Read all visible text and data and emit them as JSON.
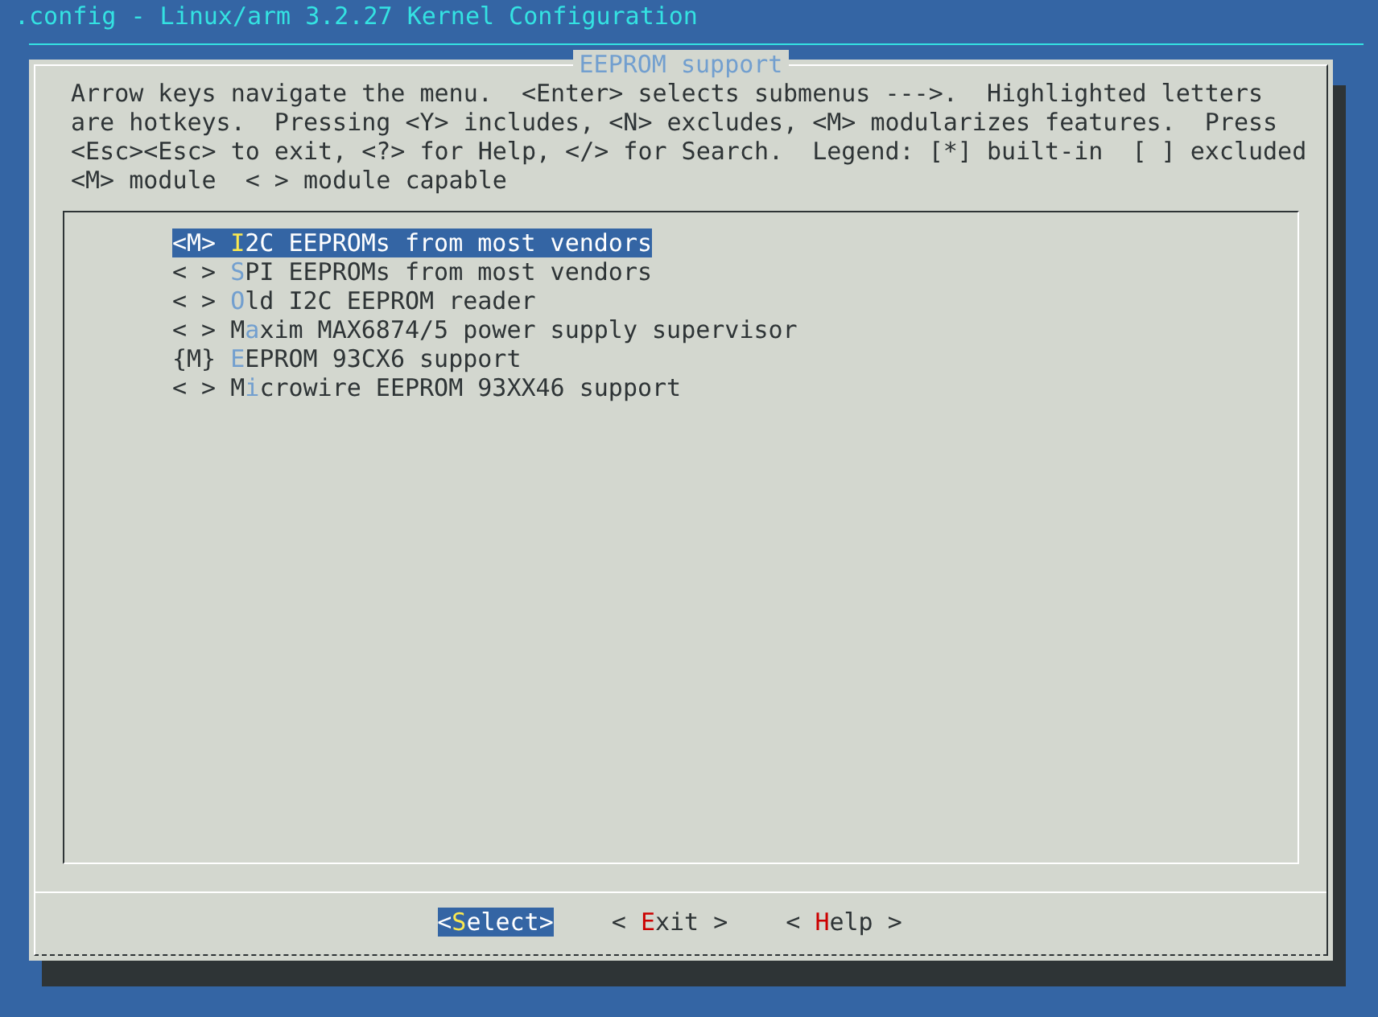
{
  "window": {
    "title": ".config - Linux/arm 3.2.27 Kernel Configuration"
  },
  "dialog": {
    "title": "EEPROM support",
    "help": "Arrow keys navigate the menu.  <Enter> selects submenus --->.  Highlighted letters\nare hotkeys.  Pressing <Y> includes, <N> excludes, <M> modularizes features.  Press\n<Esc><Esc> to exit, <?> for Help, </> for Search.  Legend: [*] built-in  [ ] excluded\n<M> module  < > module capable",
    "items": [
      {
        "marker": "<M>",
        "hotkey": "I",
        "rest": "2C EEPROMs from most vendors",
        "selected": true
      },
      {
        "marker": "< >",
        "hotkey": "S",
        "rest": "PI EEPROMs from most vendors",
        "selected": false
      },
      {
        "marker": "< >",
        "hotkey": "O",
        "rest": "ld I2C EEPROM reader",
        "selected": false
      },
      {
        "marker": "< >",
        "hotkey": "a",
        "lead": "M",
        "rest": "xim MAX6874/5 power supply supervisor",
        "selected": false
      },
      {
        "marker": "{M}",
        "hotkey": "E",
        "rest": "EPROM 93CX6 support",
        "selected": false
      },
      {
        "marker": "< >",
        "hotkey": "i",
        "lead": "M",
        "rest": "crowire EEPROM 93XX46 support",
        "selected": false
      }
    ],
    "buttons": [
      {
        "open": "<",
        "hotkey": "S",
        "rest": "elect",
        "close": ">",
        "selected": true
      },
      {
        "open": "< ",
        "hotkey": "E",
        "rest": "xit",
        "close": " >",
        "selected": false
      },
      {
        "open": "< ",
        "hotkey": "H",
        "rest": "elp",
        "close": " >",
        "selected": false
      }
    ]
  }
}
